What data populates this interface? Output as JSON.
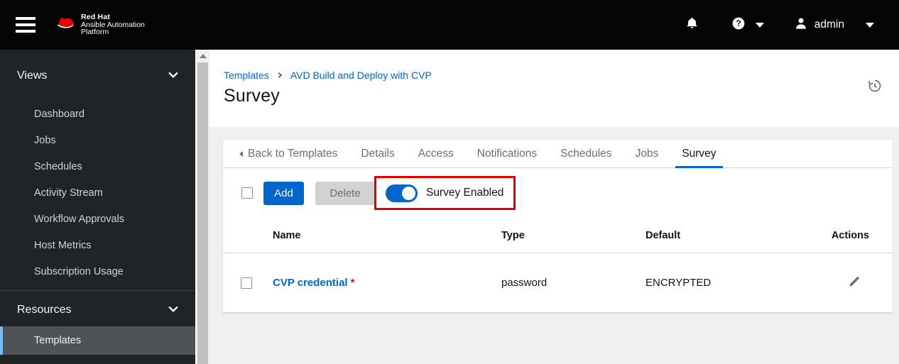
{
  "masthead": {
    "brand_line1": "Red Hat",
    "brand_line2": "Ansible Automation",
    "brand_line3": "Platform",
    "user": "admin"
  },
  "sidebar": {
    "sections": [
      {
        "label": "Views",
        "items": [
          "Dashboard",
          "Jobs",
          "Schedules",
          "Activity Stream",
          "Workflow Approvals",
          "Host Metrics",
          "Subscription Usage"
        ]
      },
      {
        "label": "Resources",
        "items": [
          "Templates"
        ]
      }
    ],
    "selected_item": "Templates"
  },
  "breadcrumb": {
    "items": [
      "Templates",
      "AVD Build and Deploy with CVP"
    ]
  },
  "page_title": "Survey",
  "tabs": {
    "back_label": "Back to Templates",
    "items": [
      "Details",
      "Access",
      "Notifications",
      "Schedules",
      "Jobs",
      "Survey"
    ],
    "active": "Survey"
  },
  "toolbar": {
    "add_label": "Add",
    "delete_label": "Delete",
    "delete_disabled": true,
    "toggle_label": "Survey Enabled",
    "toggle_on": true
  },
  "table": {
    "headers": [
      "Name",
      "Type",
      "Default",
      "Actions"
    ],
    "rows": [
      {
        "name": "CVP credential",
        "required": "*",
        "type": "password",
        "default": "ENCRYPTED"
      }
    ]
  },
  "icons": {
    "masthead": [
      "bell-icon",
      "question-circle-icon",
      "caret-down-icon",
      "user-icon",
      "caret-down-icon"
    ],
    "page": [
      "history-icon",
      "edit-pencil-icon"
    ]
  },
  "colors": {
    "accent_blue": "#0066cc",
    "highlight_red": "#e00000",
    "selected_border_blue": "#73bcf7",
    "sidebar_bg": "#212427",
    "page_bg": "#f0f0f0",
    "required_red": "#c9190b"
  }
}
